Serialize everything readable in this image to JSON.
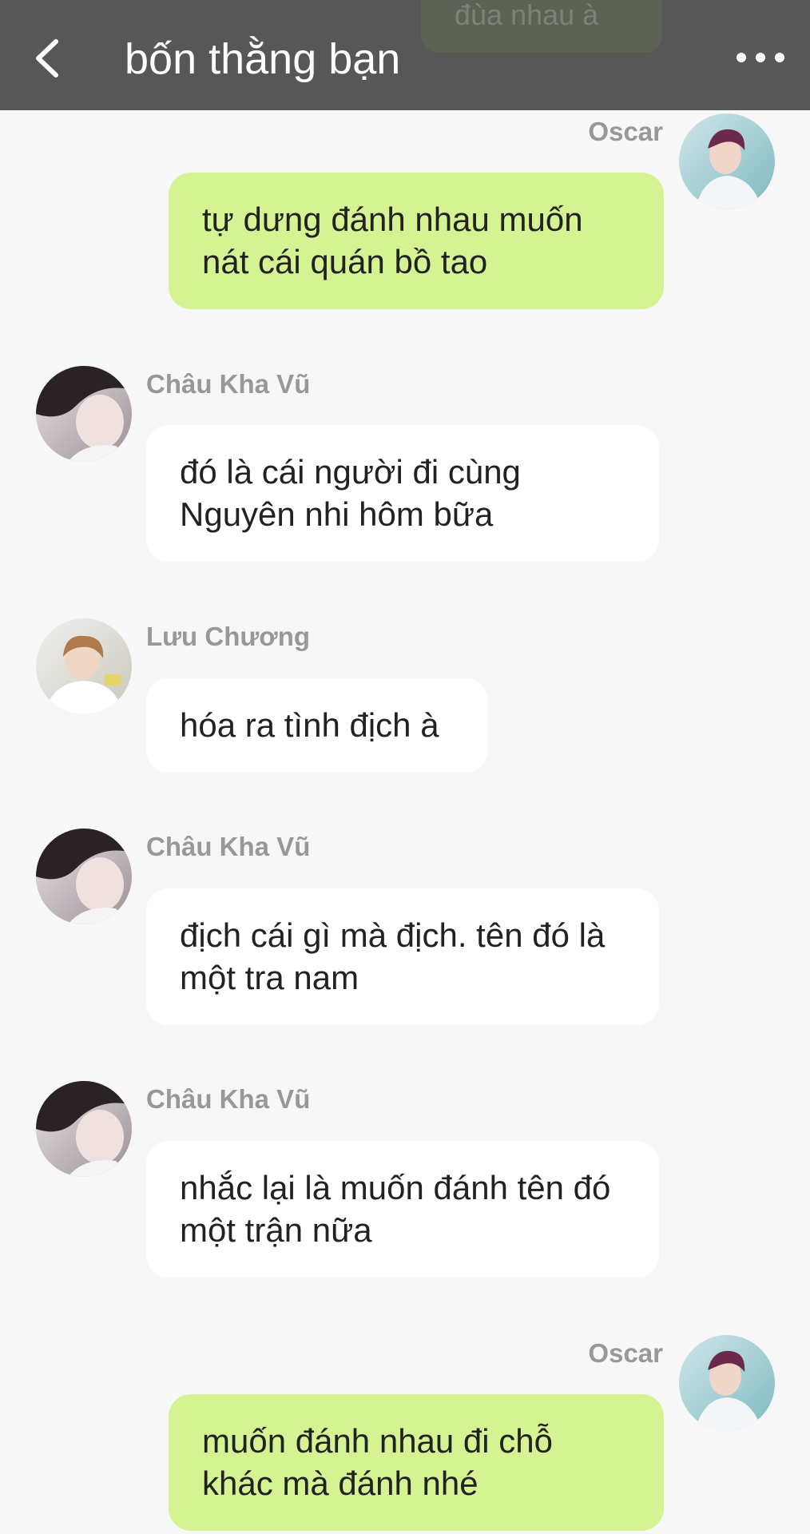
{
  "header": {
    "title": "bốn thằng bạn",
    "back_icon": "chevron-left-icon",
    "more_icon": "more-horizontal-icon",
    "peek_text": "đùa nhau à"
  },
  "colors": {
    "header_bg": "#575757",
    "outgoing_bubble": "#d6f393",
    "incoming_bubble": "#ffffff",
    "background": "#f7f7f7",
    "sender_name": "#989898"
  },
  "messages": [
    {
      "sender": "Oscar",
      "direction": "outgoing",
      "text": "tự dưng đánh nhau muốn nát cái quán bồ tao"
    },
    {
      "sender": "Châu Kha Vũ",
      "direction": "incoming",
      "text": "đó là cái người đi cùng Nguyên nhi hôm bữa"
    },
    {
      "sender": "Lưu Chương",
      "direction": "incoming",
      "text": "hóa ra tình địch à"
    },
    {
      "sender": "Châu Kha Vũ",
      "direction": "incoming",
      "text": "địch cái gì mà địch. tên đó là một tra nam"
    },
    {
      "sender": "Châu Kha Vũ",
      "direction": "incoming",
      "text": "nhắc lại là muốn đánh tên đó một trận nữa"
    },
    {
      "sender": "Oscar",
      "direction": "outgoing",
      "text": "muốn đánh nhau đi chỗ khác mà đánh nhé"
    }
  ]
}
